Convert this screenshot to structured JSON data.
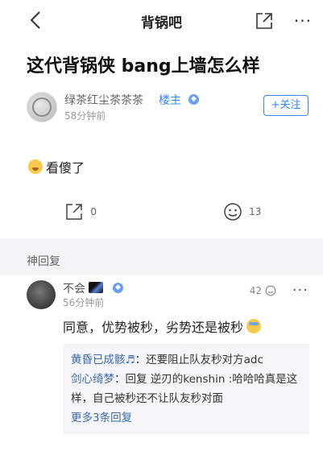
{
  "header": {
    "title": "背锅吧",
    "icons": {
      "back": "back-chevron-icon",
      "share": "share-icon",
      "more": "more-dots-icon"
    }
  },
  "post": {
    "title": "这代背锅侠 bang上墙怎么样",
    "author": {
      "name": "绿茶红尘茶茶茶",
      "role_label": "楼主",
      "time": "58分钟前",
      "follow_label": "+关注"
    },
    "body_text": "看傻了",
    "actions": {
      "share_count": "0",
      "react_count": "13"
    }
  },
  "section_label": "神回复",
  "comment": {
    "name": "不会",
    "time": "56分钟前",
    "likes": "42",
    "text": "同意，优势被秒，劣势还是被秒",
    "replies": [
      {
        "name": "黄昏已成骸♬",
        "text": "：还要阻止队友秒对方adc"
      },
      {
        "name": "剑心绮梦",
        "text": "：回复 逆刃的kenshin :哈哈哈真是这样，自己被秒还不让队友秒对面"
      }
    ],
    "more_replies": "更多3条回复"
  },
  "colors": {
    "accent": "#3385ff",
    "link": "#3d6aaf",
    "background": "#f2f3f5"
  }
}
